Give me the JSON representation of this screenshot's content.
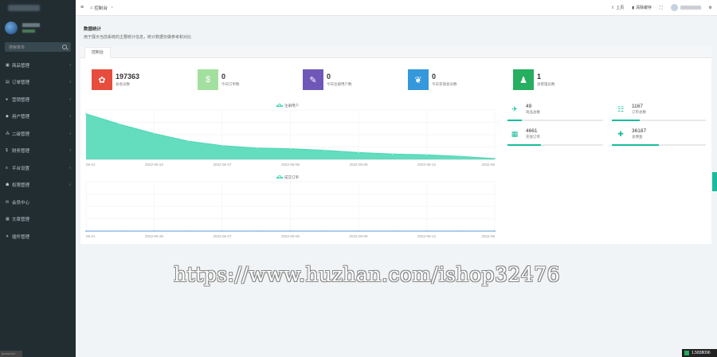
{
  "sidebar": {
    "search_placeholder": "搜索菜单",
    "items": [
      {
        "icon": "▣",
        "label": "商品管理"
      },
      {
        "icon": "▤",
        "label": "订单管理"
      },
      {
        "icon": "●",
        "label": "营销管理"
      },
      {
        "icon": "◆",
        "label": "用户管理"
      },
      {
        "icon": "⁂",
        "label": "二级管理"
      },
      {
        "icon": "$",
        "label": "财务管理"
      },
      {
        "icon": "≡",
        "label": "平台设置"
      },
      {
        "icon": "☗",
        "label": "权限管理"
      },
      {
        "icon": "✉",
        "label": "会员中心"
      },
      {
        "icon": "▦",
        "label": "文章管理"
      },
      {
        "icon": "✈",
        "label": "插件管理"
      }
    ],
    "footer": "javascript"
  },
  "topbar": {
    "menu_icon": "≡",
    "home_tab": "控制台",
    "home_icon": "⌂",
    "home_close": "×",
    "upload_label": "上页",
    "clear_cache_label": "清除缓存",
    "fullscreen_icon": "⛶",
    "settings_icon": "⚙",
    "upload_icon": "⇧",
    "cache_icon": "▮"
  },
  "page": {
    "title": "数据统计",
    "description": "用于展示当前系统的主要统计信息，统计数据仅做参考和对比"
  },
  "panel": {
    "tab_label": "控制台"
  },
  "stats": [
    {
      "value": "197363",
      "label": "总会员数",
      "color": "#e74c3c",
      "icon": "✿"
    },
    {
      "value": "0",
      "label": "今日订单数",
      "color": "#a3e0a0",
      "icon": "$"
    },
    {
      "value": "0",
      "label": "今日注册用户数",
      "color": "#6f57b8",
      "icon": "✎"
    },
    {
      "value": "0",
      "label": "今日充值会员数",
      "color": "#3498db",
      "icon": "❦"
    },
    {
      "value": "1",
      "label": "总管理员数",
      "color": "#27ae60",
      "icon": "♟"
    }
  ],
  "mini_stats": [
    {
      "value": "49",
      "label": "商品总数",
      "icon": "✈",
      "progress": 0.15
    },
    {
      "value": "1167",
      "label": "订单总数",
      "icon": "☷",
      "progress": 0.3
    },
    {
      "value": "4661",
      "label": "充值订单",
      "icon": "▦",
      "progress": 0.35
    },
    {
      "value": "36187",
      "label": "总佣金",
      "icon": "✚",
      "progress": 0.5
    }
  ],
  "chart_data": [
    {
      "type": "area",
      "legend": "注册用户",
      "x_ticks": [
        "06-21",
        "2022-06-22",
        "2022-06-27",
        "2022-06-06",
        "2022-06-09",
        "2022-06-12",
        "2022-06"
      ],
      "x": [
        0,
        1,
        2,
        3,
        4,
        5,
        6,
        7,
        8,
        9,
        10,
        11,
        12
      ],
      "values": [
        60,
        46,
        34,
        24,
        18,
        15,
        14,
        12,
        9,
        7,
        6,
        4,
        1
      ],
      "ylim": [
        0,
        65
      ],
      "color": "#49d7b4",
      "grid": true
    },
    {
      "type": "line",
      "legend": "成交订单",
      "x_ticks": [
        "06-21",
        "2022-06-26",
        "2022-06-27",
        "2022-06-06",
        "2022-06-09",
        "2022-06-12",
        "2022-06"
      ],
      "x": [
        0,
        1,
        2,
        3,
        4,
        5,
        6,
        7,
        8,
        9,
        10,
        11,
        12
      ],
      "values": [
        0,
        0,
        0,
        0,
        0,
        0,
        0,
        0,
        0,
        0,
        0,
        0,
        0
      ],
      "ylim": [
        0,
        10
      ],
      "color": "#5b9bd5",
      "grid": true
    }
  ],
  "watermark": "https://www.huzhan.com/ishop32476",
  "corner_badge": "1.5838096"
}
